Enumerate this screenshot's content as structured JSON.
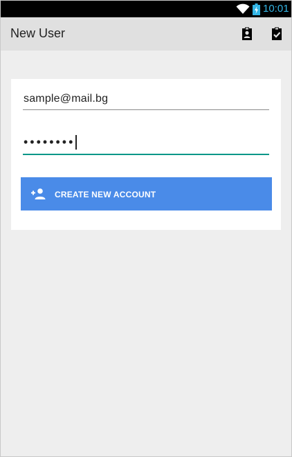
{
  "status_bar": {
    "time": "10:01"
  },
  "toolbar": {
    "title": "New User",
    "actions": [
      {
        "icon": "clipboard-account-icon"
      },
      {
        "icon": "clipboard-check-icon"
      }
    ]
  },
  "form": {
    "email_value": "sample@mail.bg",
    "password_value": "••••••••",
    "create_button_label": "CREATE NEW ACCOUNT",
    "create_button_icon": "person-add-icon"
  },
  "colors": {
    "status_bar_bg": "#000000",
    "clock": "#33b5e5",
    "toolbar_bg": "#e0e0e0",
    "page_bg": "#eeeeee",
    "focused_underline": "#009688",
    "button_bg": "#4a8be8"
  }
}
